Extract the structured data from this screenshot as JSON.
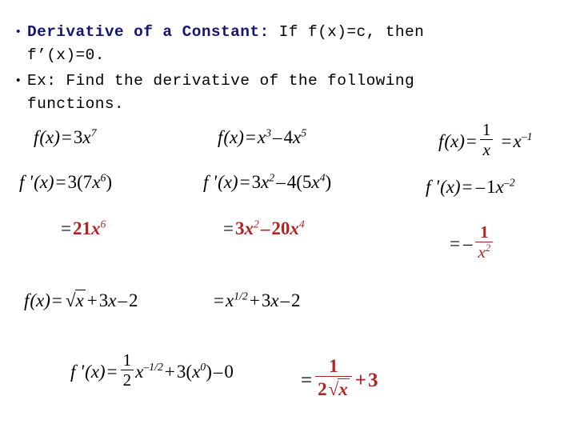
{
  "slide": {
    "title_hint": "Derivative of a Constant and Power Rule Examples",
    "background_color": "#ffffff",
    "accent_blue": "#151573",
    "accent_red": "#b02523",
    "text_black": "#000000"
  },
  "bullets": [
    {
      "marker": "•",
      "marker_color": "blue",
      "emphasis": "Derivative of a Constant:",
      "rest": " If f(x)=c, then",
      "line2": "f’(x)=0."
    },
    {
      "marker": "•",
      "marker_color": "black",
      "emphasis": "",
      "rest": "Ex: Find the derivative of the following",
      "line2": "functions."
    }
  ],
  "examples": {
    "col1": {
      "line1": {
        "lhs_f": "f",
        "lhs_arg": "(x)",
        "eq": "=",
        "coef": "3",
        "var": "x",
        "exp": "7"
      },
      "line2": {
        "lhs_f": "f '",
        "lhs_arg": "(x)",
        "eq": "=",
        "outer": "3(",
        "coef": "7",
        "var": "x",
        "exp": "6",
        "close": ")"
      },
      "answer": {
        "eq": "=",
        "coef": "21",
        "var": "x",
        "exp": "6"
      }
    },
    "col2": {
      "line1": {
        "lhs_f": "f",
        "lhs_arg": "(x)",
        "eq": "=",
        "t1_var": "x",
        "t1_exp": "3",
        "op": "–",
        "t2_coef": "4",
        "t2_var": "x",
        "t2_exp": "5"
      },
      "line2": {
        "lhs_f": "f '",
        "lhs_arg": "(x)",
        "eq": "=",
        "t1_coef": "3",
        "t1_var": "x",
        "t1_exp": "2",
        "op": "–",
        "t2_outer": "4(",
        "t2_coef": "5",
        "t2_var": "x",
        "t2_exp": "4",
        "close": ")"
      },
      "answer": {
        "eq": "=",
        "t1_coef": "3",
        "t1_var": "x",
        "t1_exp": "2",
        "op": "–",
        "t2_coef": "20",
        "t2_var": "x",
        "t2_exp": "4"
      }
    },
    "col3": {
      "line1": {
        "lhs_f": "f",
        "lhs_arg": "(x)",
        "eq": "=",
        "frac_top": "1",
        "frac_bot": "x",
        "eq2": "=",
        "var": "x",
        "exp": "–1"
      },
      "line2": {
        "lhs_f": "f '",
        "lhs_arg": "(x)",
        "eq": "=",
        "sign": "–",
        "coef": "1",
        "var": "x",
        "exp": "–2"
      },
      "answer": {
        "eq": "=",
        "sign": "–",
        "frac_top": "1",
        "frac_bot_var": "x",
        "frac_bot_exp": "2"
      }
    },
    "bottom": {
      "line1": {
        "lhs_f": "f",
        "lhs_arg": "(x)",
        "eq": "=",
        "radical": "√",
        "rad_body": "x",
        "plus": "+",
        "t2_coef": "3",
        "t2_var": "x",
        "minus": "–",
        "t3": "2"
      },
      "line1b": {
        "eq": "=",
        "var": "x",
        "exp": "1/2",
        "plus": "+",
        "t2_coef": "3",
        "t2_var": "x",
        "minus": "–",
        "t3": "2"
      },
      "line2": {
        "lhs_f": "f '",
        "lhs_arg": "(x)",
        "eq": "=",
        "frac_top": "1",
        "frac_bot": "2",
        "var": "x",
        "exp": "–1/2",
        "plus": "+",
        "t2_outer": "3(",
        "t2_var": "x",
        "t2_exp": "0",
        "t2_close": ")",
        "minus": "–",
        "t3": "0"
      },
      "answer": {
        "eq": "=",
        "frac_top": "1",
        "frac_bot_coef": "2",
        "frac_bot_rad": "√",
        "frac_bot_var": "x",
        "plus": "+",
        "t2": "3"
      }
    }
  }
}
